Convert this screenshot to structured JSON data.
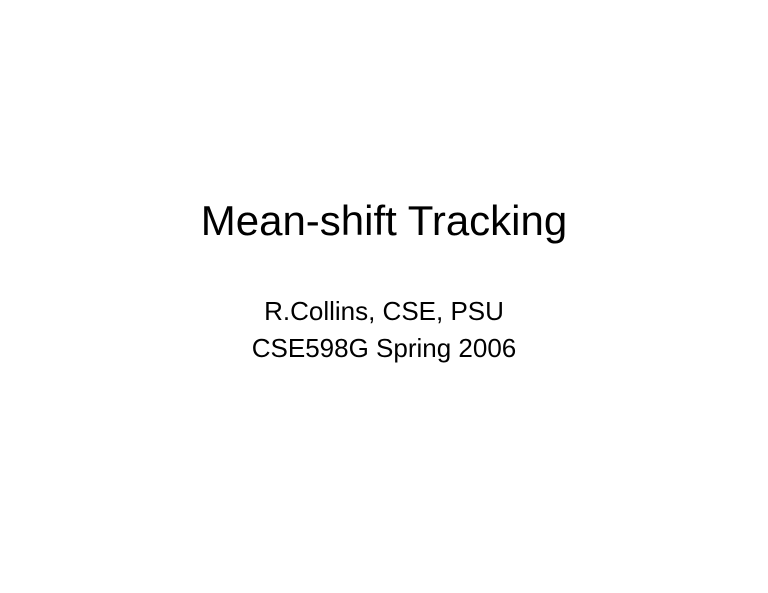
{
  "slide": {
    "title": "Mean-shift Tracking",
    "author_line": "R.Collins, CSE, PSU",
    "course_line": "CSE598G Spring 2006"
  }
}
